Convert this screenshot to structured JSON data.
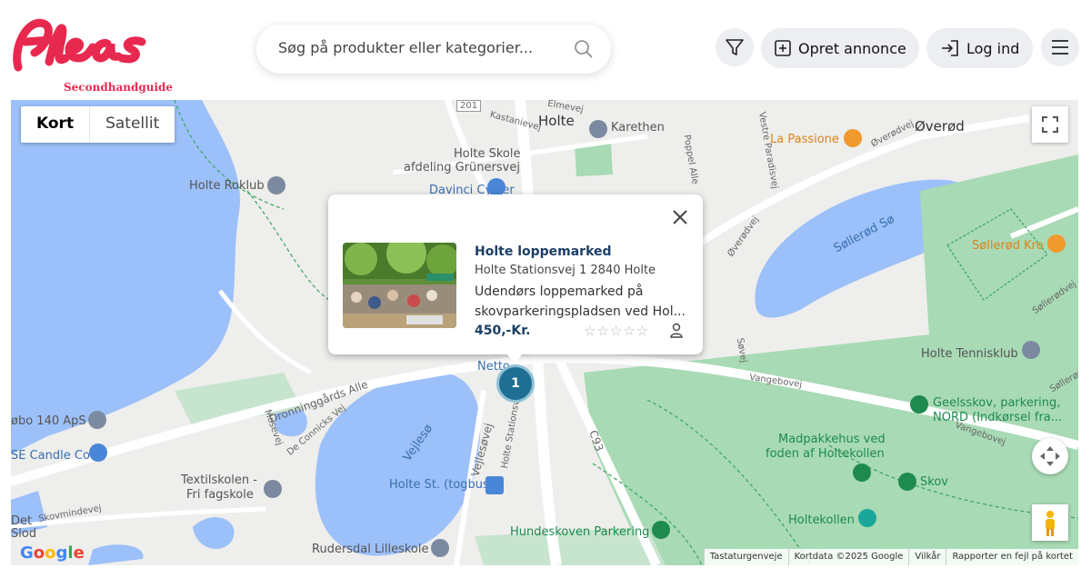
{
  "brand": {
    "logo_text": "fleas",
    "tagline": "Secondhandguide",
    "accent": "#e8294f"
  },
  "search": {
    "placeholder": "Søg på produkter eller kategorier..."
  },
  "header_actions": {
    "filter_icon": "filter-icon",
    "create_label": "Opret annonce",
    "login_label": "Log ind",
    "menu_icon": "hamburger-icon"
  },
  "map": {
    "type_map": "Kort",
    "type_satellite": "Satellit",
    "labels": {
      "holte": "Holte",
      "overod": "Øverød",
      "karethen": "Karethen",
      "la_passione": "La Passione",
      "holte_skole": "Holte Skole",
      "holte_skole_2": "afdeling Grünersvej",
      "davinci": "Davinci Cykler",
      "holte_roklub": "Holte Roklub",
      "sollerod_so": "Søllerød Sø",
      "sollerod_kro": "Søllerød Kro",
      "holte_tennis": "Holte Tennisklub",
      "geelsskov": "Geelsskov, parkering,",
      "geelsskov_2": "NORD (Indkørsel fra...",
      "madpakkehus": "Madpakkehus ved",
      "madpakkehus_2": "foden af Holtekollen",
      "skov": "Skov",
      "holtekollen": "Holtekollen",
      "hundeskoven": "Hundeskoven Parkering",
      "holte_st": "Holte St. (togbus)",
      "vejleso": "Vejlesø",
      "textilskolen": "Textilskolen -",
      "textilskolen_2": "Fri fagskole",
      "rudersdal": "Rudersdal Lilleskole",
      "obo": "øbo 140 ApS",
      "candle": "SE Candle Co",
      "det": "Det",
      "slod": "Slod",
      "netto": "Netto",
      "dronninggards": "Dronninggårds Alle",
      "vangebovej": "Vangebovej",
      "overodvej": "Øverødvej",
      "skovmindevej": "Skovmindevej",
      "vejlesovej": "Vejlesøvej",
      "holte_stationsvej": "Holte Stationsvej",
      "c93": "C93",
      "road_201": "201",
      "kastanievej": "Kastanievej",
      "elmevej": "Elmevej",
      "poppel": "Poppel Alle",
      "vestre": "Vestre Paradisvej",
      "sollerodvej": "Søllerødvej",
      "sovej": "Søvej",
      "mosevej": "Mosevej",
      "de_connicks": "De Connicks Vej"
    },
    "cluster_count": "1",
    "google": "Google",
    "footer": [
      "Tastaturgenveje",
      "Kortdata ©2025 Google",
      "Vilkår",
      "Rapporter en fejl på kortet"
    ],
    "colors": {
      "water": "#9cc0f9",
      "park": "#a8dab5",
      "land": "#eeeeec",
      "road": "#ffffff"
    }
  },
  "popup": {
    "title": "Holte loppemarked",
    "address": "Holte Stationsvej 1 2840 Holte",
    "description": "Udendørs loppemarked på skovparkeringspladsen ved Hol...",
    "price": "450,-Kr.",
    "stars": "☆☆☆☆☆",
    "rating_count": 0
  }
}
